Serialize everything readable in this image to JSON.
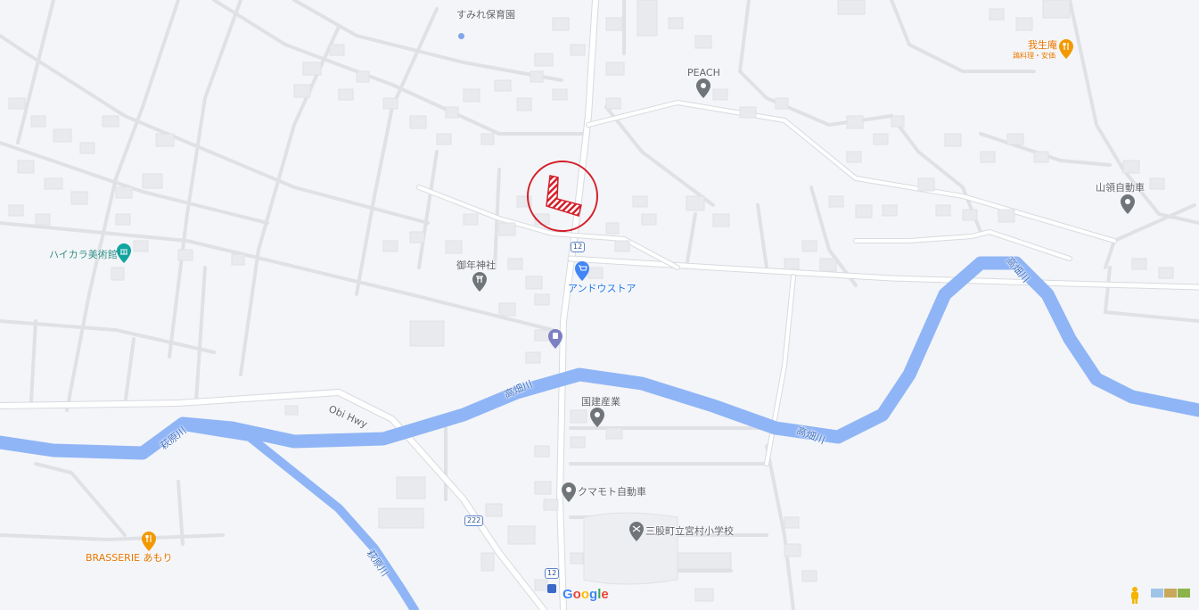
{
  "map": {
    "colors": {
      "background": "#f4f5f8",
      "road": "#ffffff",
      "road_edge": "#dadce0",
      "building": "#e8eaed",
      "river": "#8fb5f6",
      "highlight": "#d3202a"
    },
    "places": [
      {
        "name": "すみれ保育園",
        "icon": "generic-pin"
      },
      {
        "name": "PEACH",
        "icon": "gray-pin"
      },
      {
        "name": "我生庵",
        "sub": "鶏料理・安価",
        "icon": "restaurant-pin"
      },
      {
        "name": "山領自動車",
        "icon": "gray-pin"
      },
      {
        "name": "ハイカラ美術館",
        "icon": "museum-pin"
      },
      {
        "name": "御年神社",
        "icon": "shrine-pin"
      },
      {
        "name": "アンドウストア",
        "icon": "shopping-cart-pin"
      },
      {
        "name": "国建産業",
        "icon": "gray-pin"
      },
      {
        "name": "クマモト自動車",
        "icon": "gray-pin"
      },
      {
        "name": "三股町立宮村小学校",
        "icon": "school-pin"
      },
      {
        "name": "BRASSERIE あもり",
        "icon": "restaurant-pin"
      }
    ],
    "roads": [
      {
        "label": "Obi Hwy"
      }
    ],
    "rivers": [
      "高畑川",
      "高畑川",
      "高畑川",
      "萩原川",
      "萩原川"
    ],
    "route_shields": [
      "12",
      "12",
      "222"
    ],
    "attribution": {
      "logo": "Google"
    },
    "controls": {
      "pegman": "pegman-icon",
      "layers": "layer-thumbnails"
    }
  }
}
